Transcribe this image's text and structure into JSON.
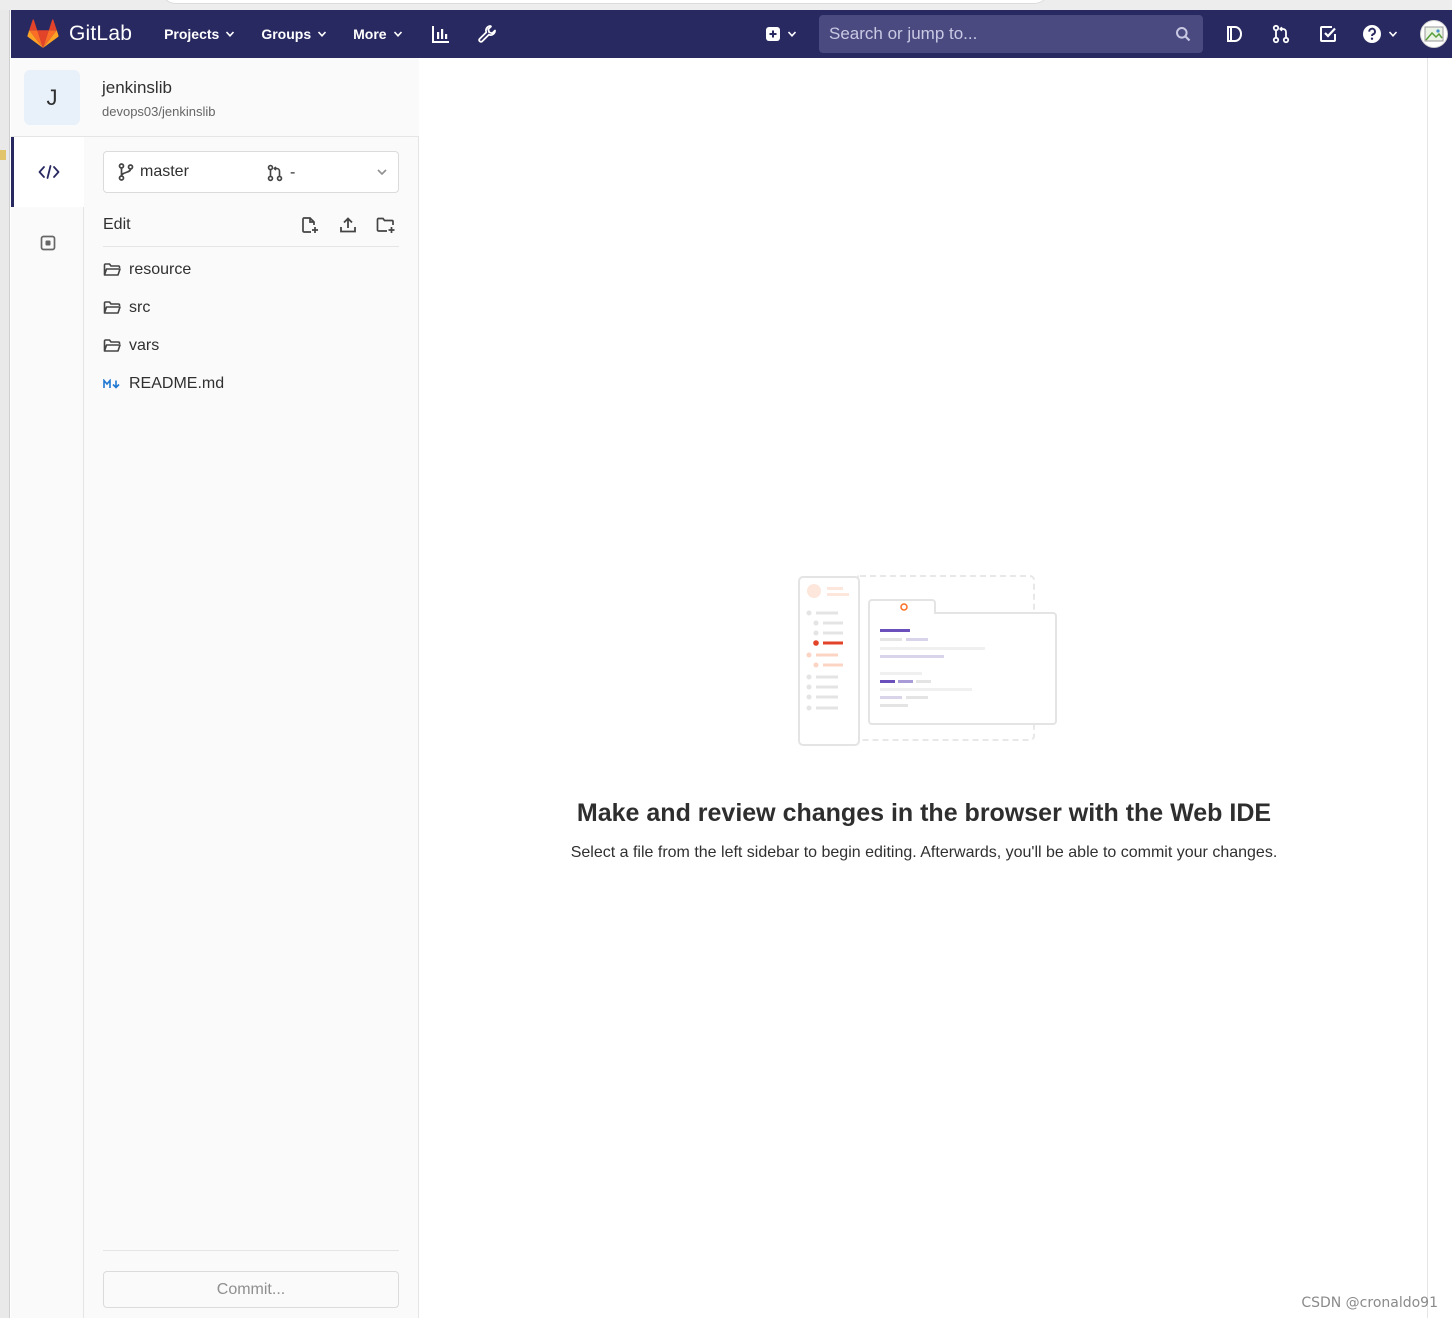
{
  "app": {
    "name": "GitLab"
  },
  "nav": {
    "items": [
      {
        "label": "Projects"
      },
      {
        "label": "Groups"
      },
      {
        "label": "More"
      }
    ],
    "search_placeholder": "Search or jump to..."
  },
  "project": {
    "initial": "J",
    "name": "jenkinslib",
    "path": "devops03/jenkinslib"
  },
  "branch": {
    "name": "master",
    "merge_request": "-"
  },
  "sidebar": {
    "edit_label": "Edit",
    "files": [
      {
        "name": "resource",
        "type": "folder"
      },
      {
        "name": "src",
        "type": "folder"
      },
      {
        "name": "vars",
        "type": "folder"
      },
      {
        "name": "README.md",
        "type": "markdown"
      }
    ],
    "commit_label": "Commit..."
  },
  "empty_state": {
    "title": "Make and review changes in the browser with the Web IDE",
    "description": "Select a file from the left sidebar to begin editing. Afterwards, you'll be able to commit your changes."
  },
  "watermark": "CSDN @cronaldo91",
  "colors": {
    "navbar": "#292961",
    "accent_orange": "#e24329",
    "accent_purple": "#6b4fbb"
  }
}
